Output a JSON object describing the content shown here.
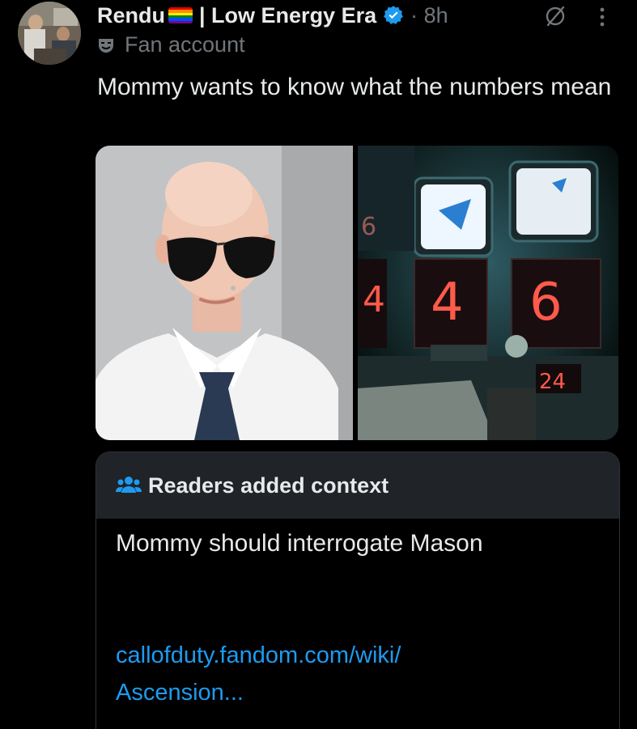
{
  "author": {
    "name": "Rendu",
    "name_suffix": "| Low Energy Era",
    "time": "· 8h",
    "label": "Fan account"
  },
  "tweet": {
    "text": "Mommy wants to know what the numbers mean"
  },
  "media": {
    "right_numbers": [
      "6",
      "4",
      "4",
      "6",
      "24"
    ]
  },
  "context": {
    "title": "Readers added context",
    "body": "Mommy should interrogate Mason",
    "link_line1": "callofduty.fandom.com/wiki/",
    "link_line2": "Ascension..."
  },
  "colors": {
    "background": "#000000",
    "text": "#e7e9ea",
    "muted": "#71767b",
    "link": "#1d9bf0",
    "verified": "#1d9bf0",
    "context_header": "#202327"
  },
  "icons": [
    "avatar",
    "rainbow-flag-icon",
    "verified-badge-icon",
    "grok-icon",
    "more-icon",
    "theater-mask-icon",
    "people-icon"
  ]
}
